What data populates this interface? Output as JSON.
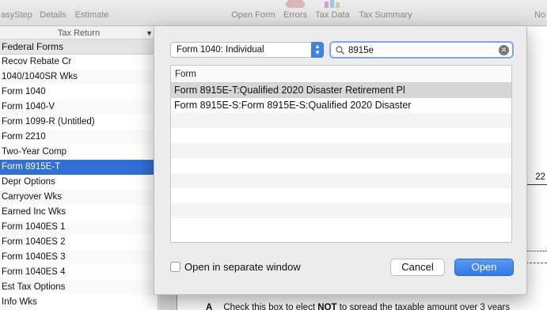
{
  "toolbar": {
    "items": [
      {
        "label": "asyStep",
        "icon": "easystep-icon"
      },
      {
        "label": "Details",
        "icon": "details-icon"
      },
      {
        "label": "Estimate",
        "icon": "estimate-icon"
      },
      {
        "label": "Open Form",
        "icon": "open-form-icon"
      },
      {
        "label": "Errors",
        "icon": "errors-icon"
      },
      {
        "label": "Tax Data",
        "icon": "tax-data-icon"
      },
      {
        "label": "Tax Summary",
        "icon": "tax-summary-icon"
      },
      {
        "label": "No",
        "icon": "notes-icon"
      }
    ]
  },
  "sidebar": {
    "header": "Tax Return",
    "group": "Federal Forms",
    "items": [
      "Recov Rebate Cr",
      "1040/1040SR Wks",
      "Form 1040",
      "Form 1040-V",
      "Form 1099-R (Untitled)",
      "Form 2210",
      "Two-Year Comp",
      "Form 8915E-T",
      "Depr Options",
      "Carryover Wks",
      "Earned Inc Wks",
      "Form 1040ES 1",
      "Form 1040ES 2",
      "Form 1040ES 3",
      "Form 1040ES 4",
      "Est Tax Options",
      "Info Wks"
    ],
    "selected_index": 7
  },
  "document": {
    "line_number": "22",
    "footer_letter": "A",
    "footer_text_pre": "Check this box to elect ",
    "footer_text_bold": "NOT",
    "footer_text_post": " to spread the taxable amount over 3 years"
  },
  "dialog": {
    "form_type": "Form 1040:  Individual",
    "search_value": "8915e",
    "column_header": "Form",
    "results": [
      "Form 8915E-T:Qualified 2020 Disaster Retirement Pl",
      "Form 8915E-S:Form 8915E-S:Qualified 2020 Disaster"
    ],
    "selected_result": 0,
    "empty_rows": 8,
    "checkbox_label": "Open in separate window",
    "checkbox_checked": false,
    "cancel_label": "Cancel",
    "open_label": "Open",
    "accent_color": "#2f78e6"
  }
}
